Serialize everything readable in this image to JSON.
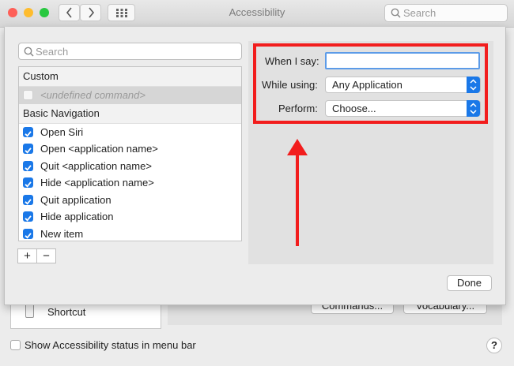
{
  "window": {
    "title": "Accessibility",
    "search_placeholder": "Search"
  },
  "traffic_lights": {
    "close": "#fe5f57",
    "minimize": "#febc2e",
    "zoom": "#28c840"
  },
  "sheet": {
    "search_placeholder": "Search",
    "list": {
      "groups": [
        {
          "label": "Custom",
          "items": [
            {
              "label": "<undefined command>",
              "checked": false,
              "disabled": true
            }
          ]
        },
        {
          "label": "Basic Navigation",
          "items": [
            {
              "label": "Open Siri",
              "checked": true
            },
            {
              "label": "Open <application name>",
              "checked": true
            },
            {
              "label": "Quit <application name>",
              "checked": true
            },
            {
              "label": "Hide <application name>",
              "checked": true
            },
            {
              "label": "Quit application",
              "checked": true
            },
            {
              "label": "Hide application",
              "checked": true
            },
            {
              "label": "New item",
              "checked": true
            }
          ]
        }
      ]
    },
    "add_label": "+",
    "remove_label": "−",
    "form": {
      "when_label": "When I say:",
      "when_value": "",
      "while_label": "While using:",
      "while_value": "Any Application",
      "perform_label": "Perform:",
      "perform_value": "Choose..."
    },
    "done_label": "Done"
  },
  "background": {
    "shortcut_label": "Shortcut",
    "commands_button": "Commands...",
    "vocabulary_button": "Vocabulary...",
    "status_checkbox_label": "Show Accessibility status in menu bar",
    "help_label": "?"
  },
  "colors": {
    "accent": "#1a78e8",
    "highlight": "#f21d1d"
  }
}
